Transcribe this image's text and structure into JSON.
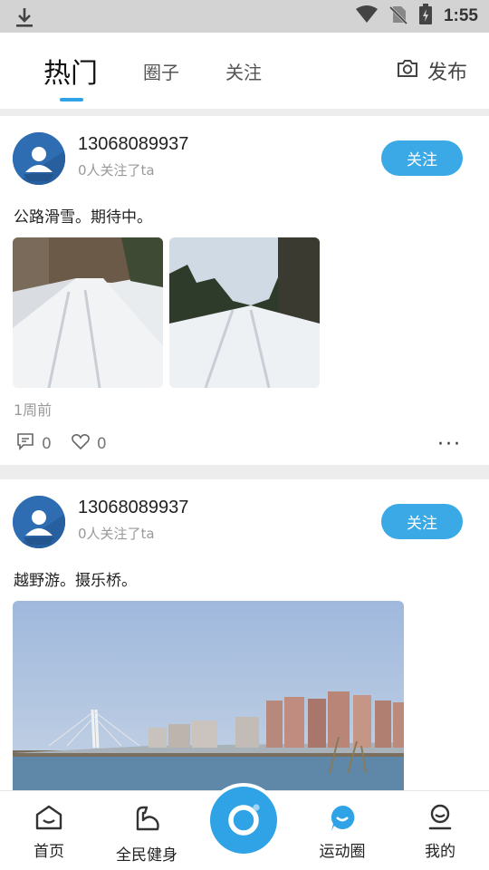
{
  "status_bar": {
    "time": "1:55",
    "icons": [
      "download-icon",
      "wifi-icon",
      "no-sim-icon",
      "battery-charging-icon"
    ]
  },
  "header": {
    "tabs": [
      {
        "label": "热门",
        "active": true
      },
      {
        "label": "圈子",
        "active": false
      },
      {
        "label": "关注",
        "active": false
      }
    ],
    "publish_label": "发布",
    "accent_color": "#2fa3e6"
  },
  "posts": [
    {
      "username": "13068089937",
      "followers_text": "0人关注了ta",
      "follow_label": "关注",
      "text": "公路滑雪。期待中。",
      "time_ago": "1周前",
      "comment_count": "0",
      "like_count": "0",
      "more_label": "···"
    },
    {
      "username": "13068089937",
      "followers_text": "0人关注了ta",
      "follow_label": "关注",
      "text": "越野游。摄乐桥。"
    }
  ],
  "bottom_nav": {
    "items": [
      {
        "label": "首页",
        "icon": "home-icon",
        "active": false
      },
      {
        "label": "全民健身",
        "icon": "muscle-icon",
        "active": false
      },
      {
        "label": "运动圈",
        "icon": "sports-circle-icon",
        "active": true
      },
      {
        "label": "我的",
        "icon": "profile-icon",
        "active": false
      }
    ],
    "center_icon": "camera-lens-icon"
  }
}
